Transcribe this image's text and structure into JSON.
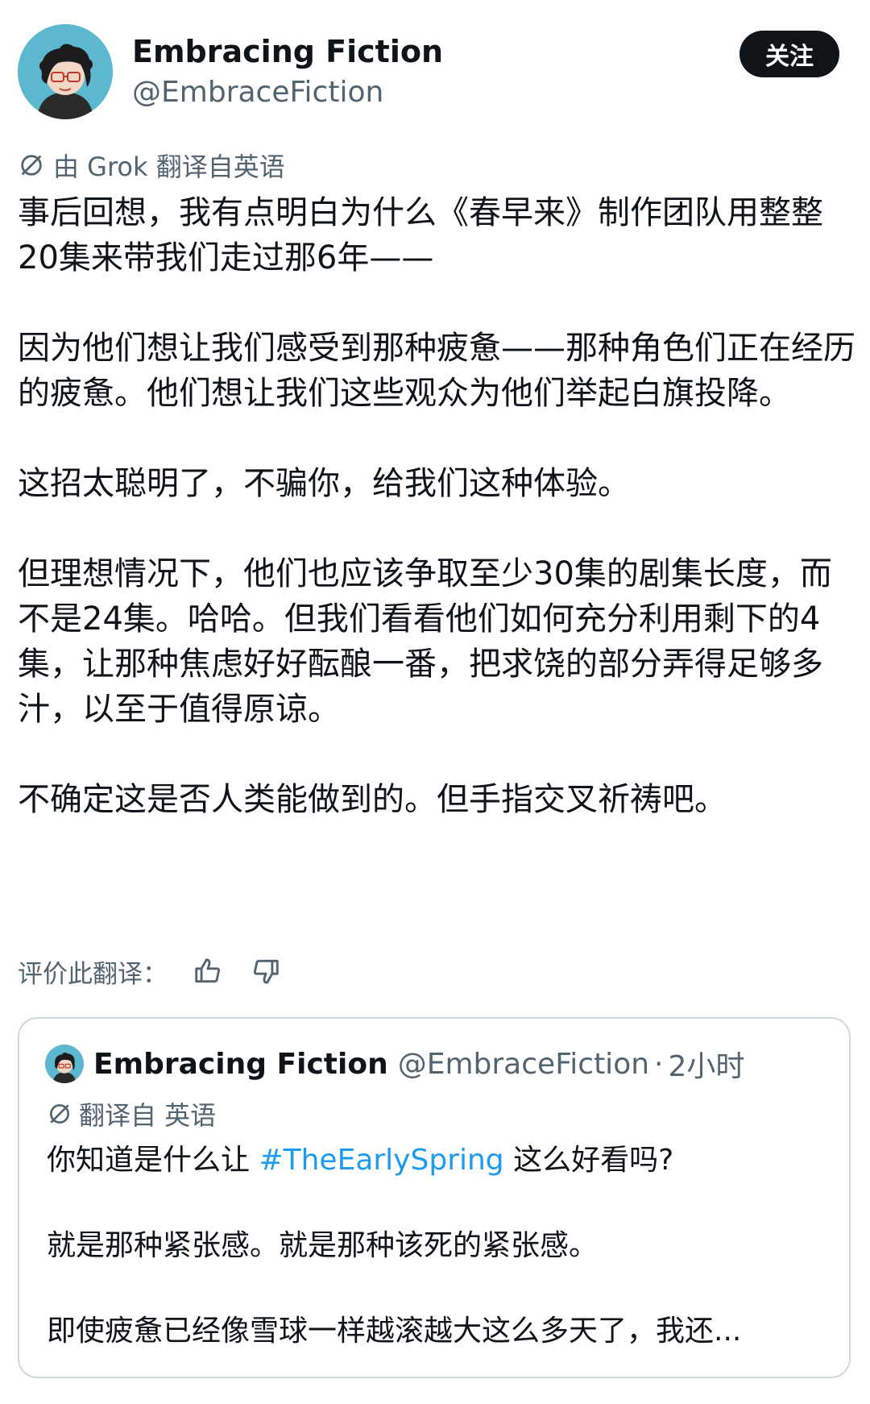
{
  "author": {
    "display_name": "Embracing Fiction",
    "handle": "@EmbraceFiction",
    "avatar_bg": "#5bb8cf"
  },
  "follow_label": "关注",
  "translation_note": "由 Grok 翻译自英语",
  "post_paragraphs": [
    "事后回想，我有点明白为什么《春早来》制作团队用整整20集来带我们走过那6年——",
    "因为他们想让我们感受到那种疲惫——那种角色们正在经历的疲惫。他们想让我们这些观众为他们举起白旗投降。",
    "这招太聪明了，不骗你，给我们这种体验。",
    "但理想情况下，他们也应该争取至少30集的剧集长度，而不是24集。哈哈。但我们看看他们如何充分利用剩下的4集，让那种焦虑好好酝酿一番，把求饶的部分弄得足够多汁，以至于值得原谅。",
    "不确定这是否人类能做到的。但手指交叉祈祷吧。"
  ],
  "rate_label": "评价此翻译：",
  "icons": {
    "translate": "translate-icon",
    "thumbs_up": "thumbs-up-icon",
    "thumbs_down": "thumbs-down-icon"
  },
  "quoted": {
    "display_name": "Embracing Fiction",
    "handle": "@EmbraceFiction",
    "separator": "·",
    "time": "2小时",
    "translation_note": "翻译自 英语",
    "line1_before": "你知道是什么让 ",
    "hashtag": "#TheEarlySpring",
    "line1_after": " 这么好看吗?",
    "line2": "就是那种紧张感。就是那种该死的紧张感。",
    "line3": "即使疲惫已经像雪球一样越滚越大这么多天了，我还..."
  },
  "colors": {
    "text": "#0f1419",
    "secondary": "#536471",
    "link": "#1d9bf0",
    "button_bg": "#0f1419",
    "border": "#cfd9de"
  }
}
